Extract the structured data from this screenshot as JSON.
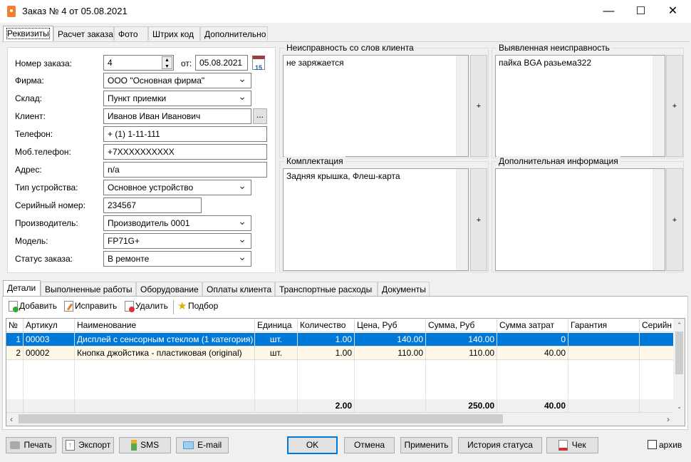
{
  "window": {
    "title": "Заказ № 4 от 05.08.2021",
    "min": "—",
    "max": "☐",
    "close": "✕"
  },
  "tabs": [
    "Реквизиты",
    "Расчет заказа",
    "Фото",
    "Штрих код",
    "Дополнительно"
  ],
  "form": {
    "order_no_label": "Номер заказа:",
    "order_no": "4",
    "from_label": "от:",
    "date": "05.08.2021",
    "calendar_day": "15",
    "firm_label": "Фирма:",
    "firm": "ООО \"Основная фирма\"",
    "warehouse_label": "Склад:",
    "warehouse": "Пункт приемки",
    "client_label": "Клиент:",
    "client": "Иванов Иван Иванович",
    "client_btn": "...",
    "phone_label": "Телефон:",
    "phone": "+ (1) 1-11-111",
    "mobile_label": "Моб.телефон:",
    "mobile": "+7XXXXXXXXXX",
    "address_label": "Адрес:",
    "address": "n/a",
    "device_type_label": "Тип устройства:",
    "device_type": "Основное устройство",
    "serial_label": "Серийный номер:",
    "serial": "234567",
    "maker_label": "Производитель:",
    "maker": "Производитель 0001",
    "model_label": "Модель:",
    "model": "FP71G+",
    "status_label": "Статус заказа:",
    "status": "В ремонте"
  },
  "memos": {
    "client_fault": {
      "title": "Неисправность со слов клиента",
      "text": "не заряжается"
    },
    "found_fault": {
      "title": "Выявленная неисправность",
      "text": "пайка BGA разьема322"
    },
    "kit": {
      "title": "Комплектация",
      "text": "Задняя крышка, Флеш-карта"
    },
    "extra": {
      "title": "Дополнительная информация",
      "text": ""
    },
    "plus": "+"
  },
  "bottom_tabs": [
    "Детали",
    "Выполненные работы",
    "Оборудование",
    "Оплаты клиента",
    "Транспортные расходы",
    "Документы"
  ],
  "toolbar": {
    "add": "Добавить",
    "edit": "Исправить",
    "delete": "Удалить",
    "pick": "Подбор"
  },
  "grid": {
    "columns": [
      "№",
      "Артикул",
      "Наименование",
      "Единица",
      "Количество",
      "Цена, Руб",
      "Сумма, Руб",
      "Сумма затрат",
      "Гарантия",
      "Серийн"
    ],
    "rows": [
      [
        "1",
        "00003",
        "Дисплей с сенсорным стеклом (1 категория)",
        "шт.",
        "1.00",
        "140.00",
        "140.00",
        "0",
        "",
        ""
      ],
      [
        "2",
        "00002",
        "Кнопка джойстика - пластиковая (original)",
        "шт.",
        "1.00",
        "110.00",
        "110.00",
        "40.00",
        "",
        ""
      ]
    ],
    "totals": [
      "",
      "",
      "",
      "",
      "2.00",
      "",
      "250.00",
      "40.00",
      "",
      ""
    ],
    "selected_row": 0
  },
  "buttons": {
    "print": "Печать",
    "export": "Экспорт",
    "sms": "SMS",
    "email": "E-mail",
    "ok": "OK",
    "cancel": "Отмена",
    "apply": "Применить",
    "history": "История статуса",
    "receipt": "Чек",
    "archive": "архив"
  },
  "colors": {
    "selection": "#0078d7",
    "row_alt": "#fdf8e8"
  }
}
